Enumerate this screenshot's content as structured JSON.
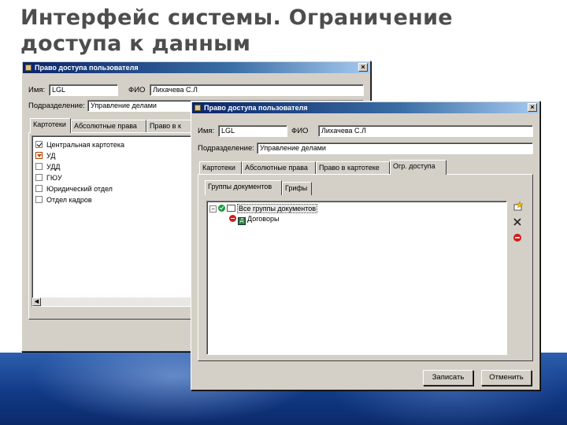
{
  "slide": {
    "title_line1": "Интерфейс системы. Ограничение",
    "title_line2": "доступа к данным"
  },
  "back_window": {
    "title": "Право доступа пользователя",
    "close": "×",
    "name_label": "Имя:",
    "name_value": "LGL",
    "fio_label": "ФИО",
    "fio_value": "Лихачева С.Л",
    "dept_label": "Подразделение:",
    "dept_value": "Управление делами",
    "tabs": [
      "Картотеки",
      "Абсолютные права",
      "Право в к"
    ],
    "items": [
      {
        "label": "Центральная картотека",
        "state": "checked"
      },
      {
        "label": "УД",
        "state": "partial"
      },
      {
        "label": "УДД",
        "state": "unchecked"
      },
      {
        "label": "ГЮУ",
        "state": "unchecked"
      },
      {
        "label": "Юридический отдел",
        "state": "unchecked"
      },
      {
        "label": "Отдел кадров",
        "state": "unchecked"
      }
    ]
  },
  "front_window": {
    "title": "Право доступа пользователя",
    "close": "×",
    "name_label": "Имя:",
    "name_value": "LGL",
    "fio_label": "ФИО",
    "fio_value": "Лихачева С.Л",
    "dept_label": "Подразделение:",
    "dept_value": "Управление делами",
    "tabs": [
      "Картотеки",
      "Абсолютные права",
      "Право в картотеке",
      "Огр. доступа"
    ],
    "subtabs": [
      "Группы документов",
      "Грифы"
    ],
    "tree": [
      {
        "expander": "−",
        "label": "Все группы документов",
        "status": "allowed"
      },
      {
        "expander": "",
        "label": "Договоры",
        "status": "denied"
      }
    ],
    "tools": {
      "add": "add",
      "delete": "delete",
      "deny": "deny"
    },
    "save_label": "Записать",
    "cancel_label": "Отменить"
  },
  "colors": {
    "titlebar_start": "#0a246a",
    "titlebar_end": "#a6caf0",
    "dialog_face": "#d4d0c8",
    "slide_title": "#4d4d4d",
    "band": "#123a86"
  }
}
